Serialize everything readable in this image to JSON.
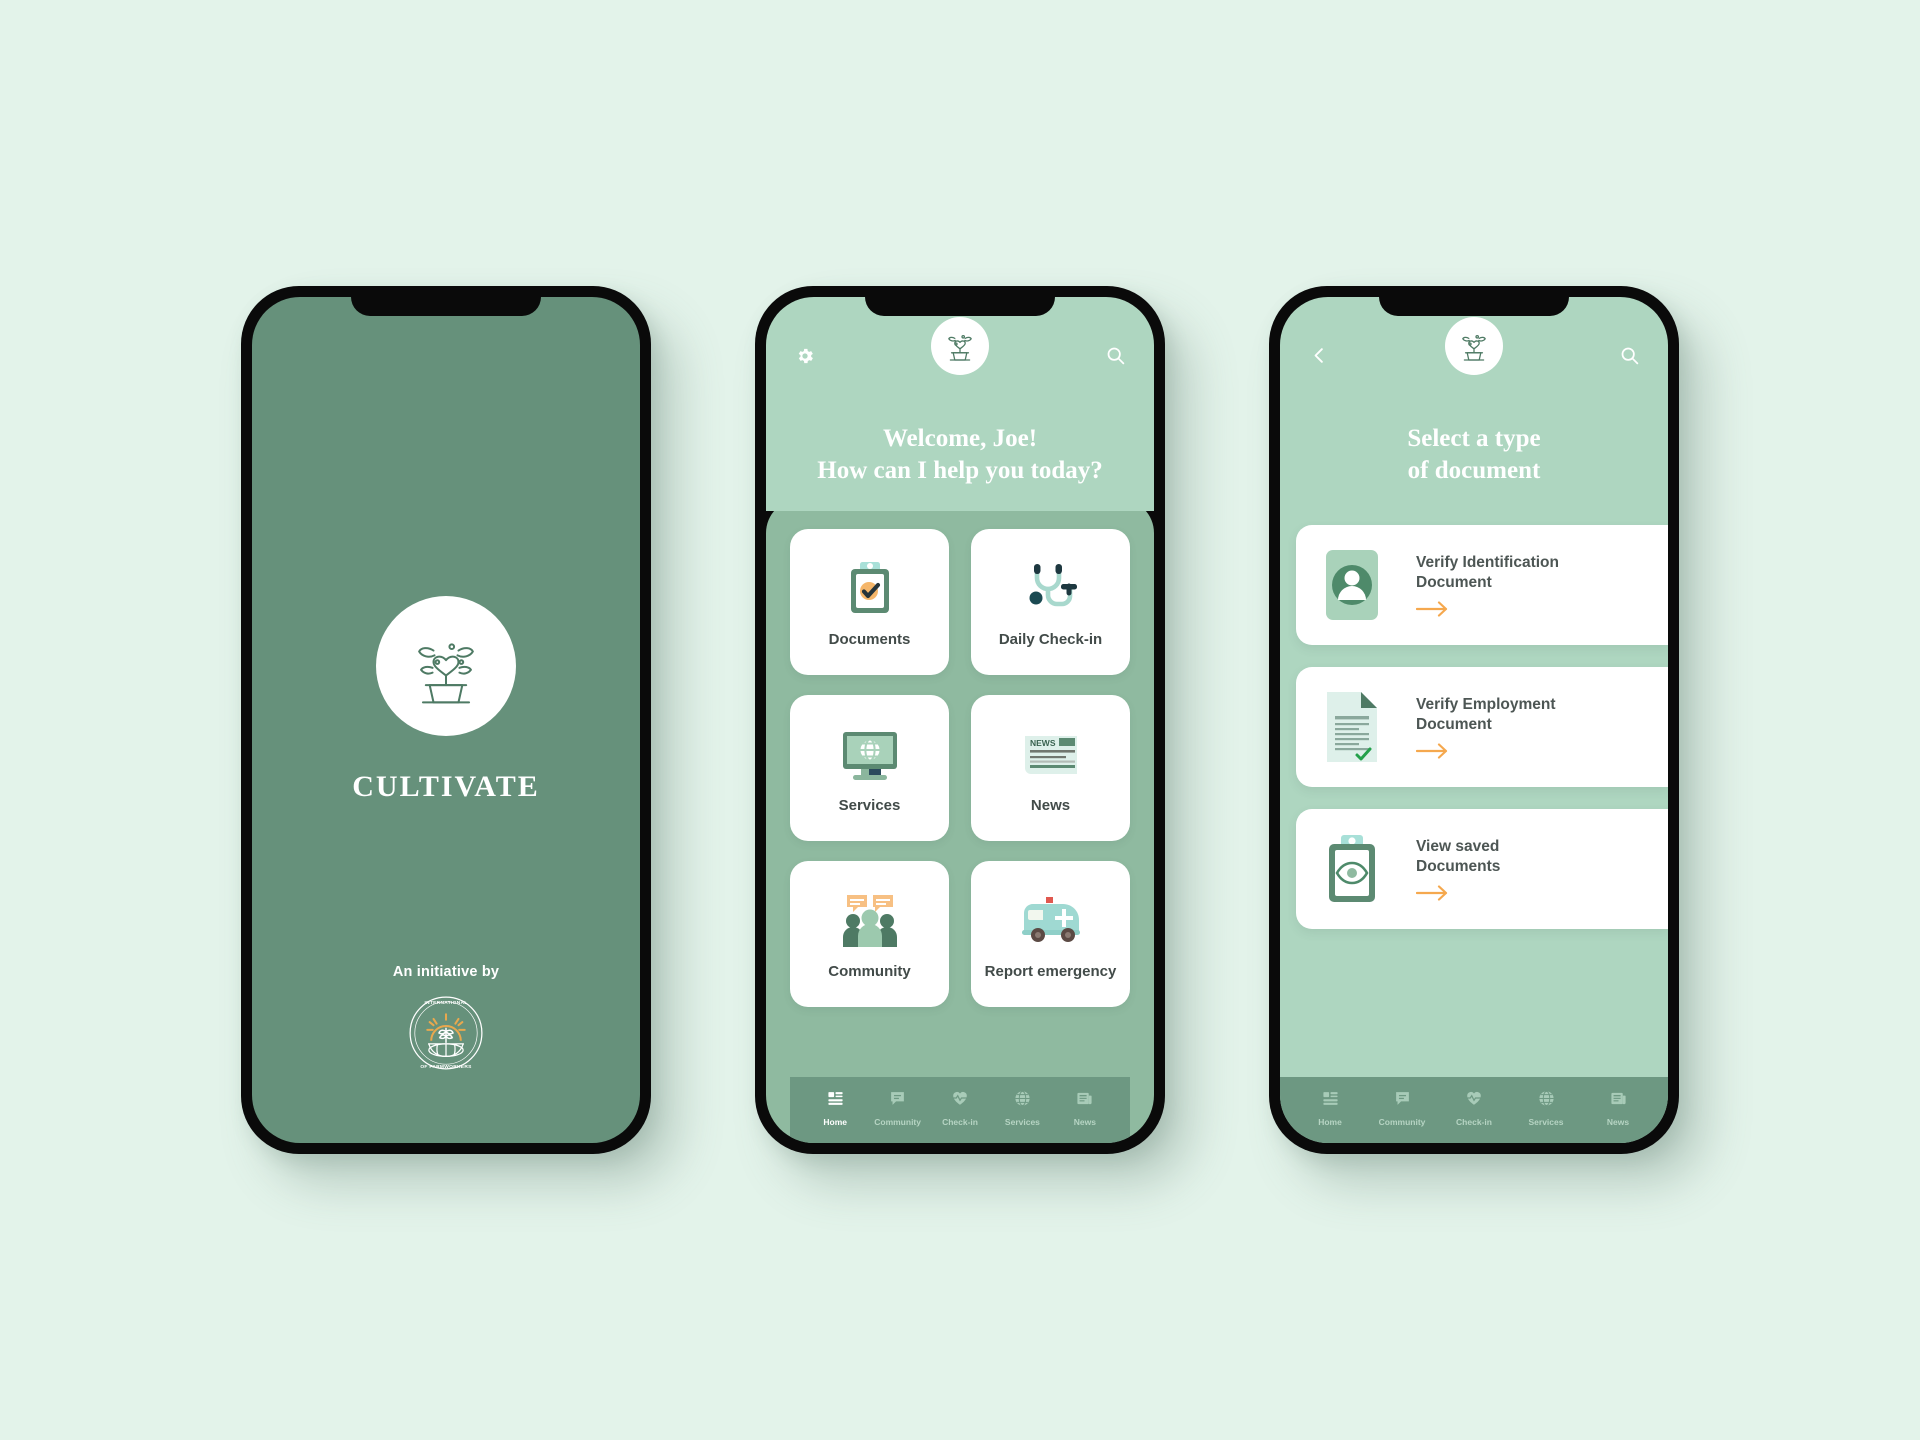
{
  "theme": {
    "page_background": "#e3f3ea",
    "splash_green": "#66917b",
    "header_mint": "#aed6c0",
    "panel_green": "#8fbaa0",
    "tabbar_green": "#6d9882",
    "accent_orange": "#f5a84e",
    "text_dark": "#424b49"
  },
  "splash": {
    "logo_icon": "potted-plant-heart-icon",
    "brand": "CULTIVATE",
    "initiative_label": "An initiative by",
    "consortium_top_text": "INTERNATIONAL CONSORTIUM",
    "consortium_bottom_text": "OF FARMWORKERS",
    "consortium_icon": "globe-sunrise-plant-badge-icon"
  },
  "home": {
    "settings_icon": "gear-icon",
    "search_icon": "search-icon",
    "logo_icon": "potted-plant-heart-icon",
    "greeting_line1": "Welcome, Joe!",
    "greeting_line2": "How can I help you today?",
    "tiles": [
      {
        "label": "Documents",
        "icon": "clipboard-check-icon"
      },
      {
        "label": "Daily Check-in",
        "icon": "stethoscope-icon"
      },
      {
        "label": "Services",
        "icon": "monitor-globe-icon"
      },
      {
        "label": "News",
        "icon": "newspaper-icon"
      },
      {
        "label": "Community",
        "icon": "people-chat-icon"
      },
      {
        "label": "Report emergency",
        "icon": "ambulance-icon"
      }
    ]
  },
  "documents": {
    "back_icon": "chevron-left-icon",
    "search_icon": "search-icon",
    "logo_icon": "potted-plant-heart-icon",
    "title_line1": "Select a type",
    "title_line2": "of document",
    "cards": [
      {
        "line1": "Verify Identification",
        "line2": "Document",
        "icon": "id-card-person-icon",
        "arrow_icon": "arrow-right-icon"
      },
      {
        "line1": "Verify Employment",
        "line2": "Document",
        "icon": "document-verified-icon",
        "arrow_icon": "arrow-right-icon"
      },
      {
        "line1": "View saved",
        "line2": "Documents",
        "icon": "clipboard-eye-icon",
        "arrow_icon": "arrow-right-icon"
      }
    ]
  },
  "tabbar": {
    "items": [
      {
        "label": "Home",
        "icon": "dashboard-icon",
        "active": true
      },
      {
        "label": "Community",
        "icon": "chat-bubble-icon",
        "active": false
      },
      {
        "label": "Check-in",
        "icon": "heartbeat-icon",
        "active": false
      },
      {
        "label": "Services",
        "icon": "globe-icon",
        "active": false
      },
      {
        "label": "News",
        "icon": "newspaper-icon",
        "active": false
      }
    ]
  }
}
